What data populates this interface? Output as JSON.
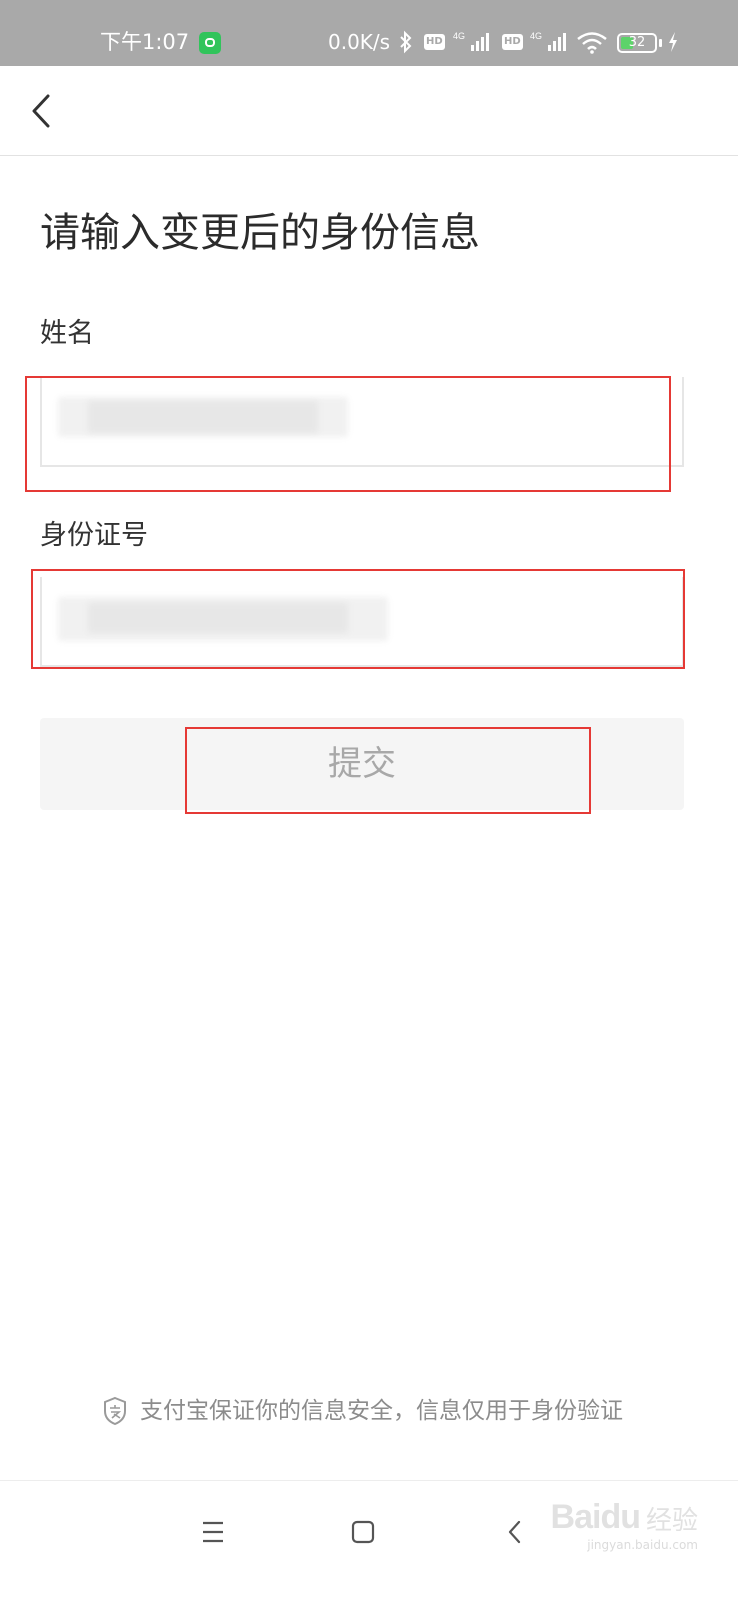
{
  "status_bar": {
    "time": "下午1:07",
    "network_speed": "0.0K/s",
    "hd_badge_1": "HD",
    "hd_badge_2": "HD",
    "signal_1_label": "4G",
    "signal_2_label": "4G",
    "battery": "32",
    "icons": [
      "app-notification-icon",
      "bluetooth-icon",
      "signal-icon",
      "wifi-icon",
      "battery-icon",
      "charging-icon"
    ]
  },
  "header": {
    "back_icon": "chevron-left-icon"
  },
  "page": {
    "title": "请输入变更后的身份信息",
    "name_label": "姓名",
    "id_label": "身份证号",
    "submit_label": "提交"
  },
  "footer": {
    "note": "支付宝保证你的信息安全，信息仅用于身份验证",
    "note_icon": "shield-icon"
  },
  "nav_bar": {
    "icons": [
      "menu-icon",
      "home-icon",
      "back-icon"
    ]
  },
  "watermark": {
    "logo": "Baidu",
    "suffix": "经验",
    "url": "jingyan.baidu.com"
  },
  "colors": {
    "annotation_red": "#e53935",
    "status_bar_bg": "#a9a9a9",
    "button_bg": "#f5f5f5"
  }
}
